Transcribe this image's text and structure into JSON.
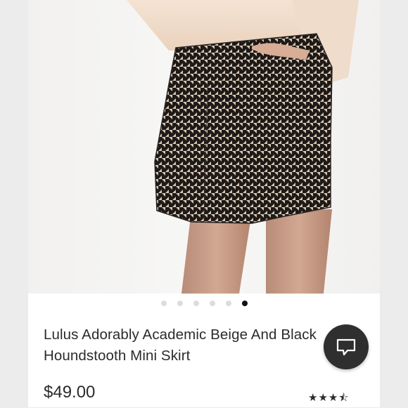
{
  "gallery": {
    "image_description_icon": "houndstooth-skirt-photo",
    "dot_count": 6,
    "active_index": 5
  },
  "product": {
    "title": "Lulus Adorably Academic Beige And Black Houndstooth Mini Skirt",
    "price": "$49.00",
    "rating_value": 3.5,
    "rating_max": 4,
    "rating_glyphs": "★★★⯪"
  },
  "chat": {
    "icon": "chat-bubble-icon"
  },
  "colors": {
    "accent_dark": "#2f2f2f",
    "pattern_light": "#d9c6b2",
    "pattern_dark": "#1d1a18"
  }
}
